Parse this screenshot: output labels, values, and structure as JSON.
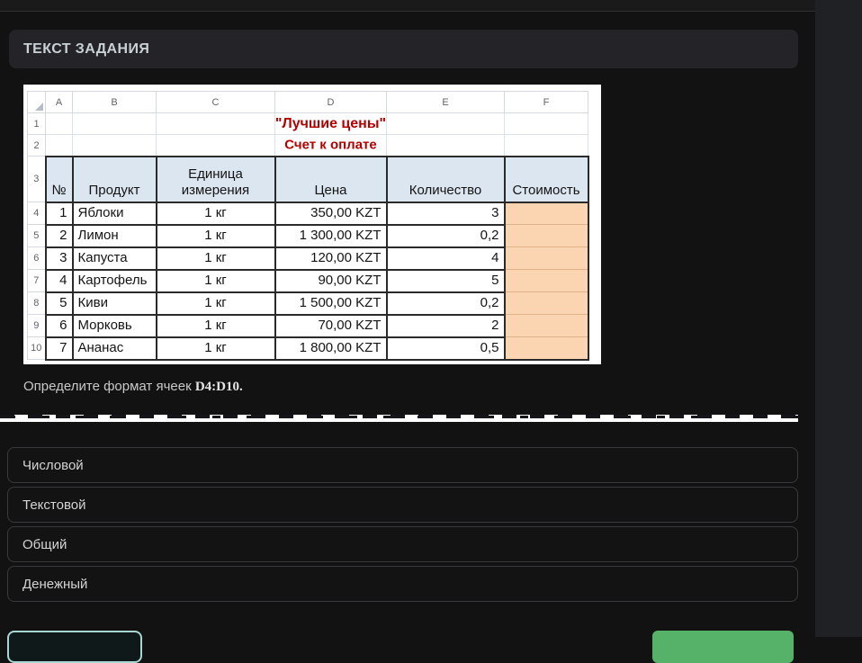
{
  "header": {
    "title": "ТЕКСТ ЗАДАНИЯ"
  },
  "task": {
    "question_prefix": "Определите формат ячеек ",
    "question_range": "D4:D10."
  },
  "spreadsheet": {
    "column_letters": [
      "A",
      "B",
      "C",
      "D",
      "E",
      "F"
    ],
    "title_row1": "\"Лучшие цены\"",
    "title_row2": "Счет к оплате",
    "headers": [
      "№",
      "Продукт",
      "Единица измерения",
      "Цена",
      "Количество",
      "Стоимость"
    ],
    "rows": [
      [
        "1",
        "Яблоки",
        "1 кг",
        "350,00 KZT",
        "3",
        ""
      ],
      [
        "2",
        "Лимон",
        "1 кг",
        "1 300,00 KZT",
        "0,2",
        ""
      ],
      [
        "3",
        "Капуста",
        "1 кг",
        "120,00 KZT",
        "4",
        ""
      ],
      [
        "4",
        "Картофель",
        "1 кг",
        "90,00 KZT",
        "5",
        ""
      ],
      [
        "5",
        "Киви",
        "1 кг",
        "1 500,00 KZT",
        "0,2",
        ""
      ],
      [
        "6",
        "Морковь",
        "1 кг",
        "70,00 KZT",
        "2",
        ""
      ],
      [
        "7",
        "Ананас",
        "1 кг",
        "1 800,00 KZT",
        "0,5",
        ""
      ]
    ],
    "colors": {
      "header_fill": "#dce6f1",
      "cost_fill": "#fbd5b1",
      "title_red": "#b30000"
    }
  },
  "options": [
    {
      "label": "Числовой"
    },
    {
      "label": "Текстовой"
    },
    {
      "label": "Общий"
    },
    {
      "label": "Денежный"
    }
  ],
  "footer": {
    "accent_teal": "#a9d6d1",
    "accent_green": "#56b269"
  }
}
